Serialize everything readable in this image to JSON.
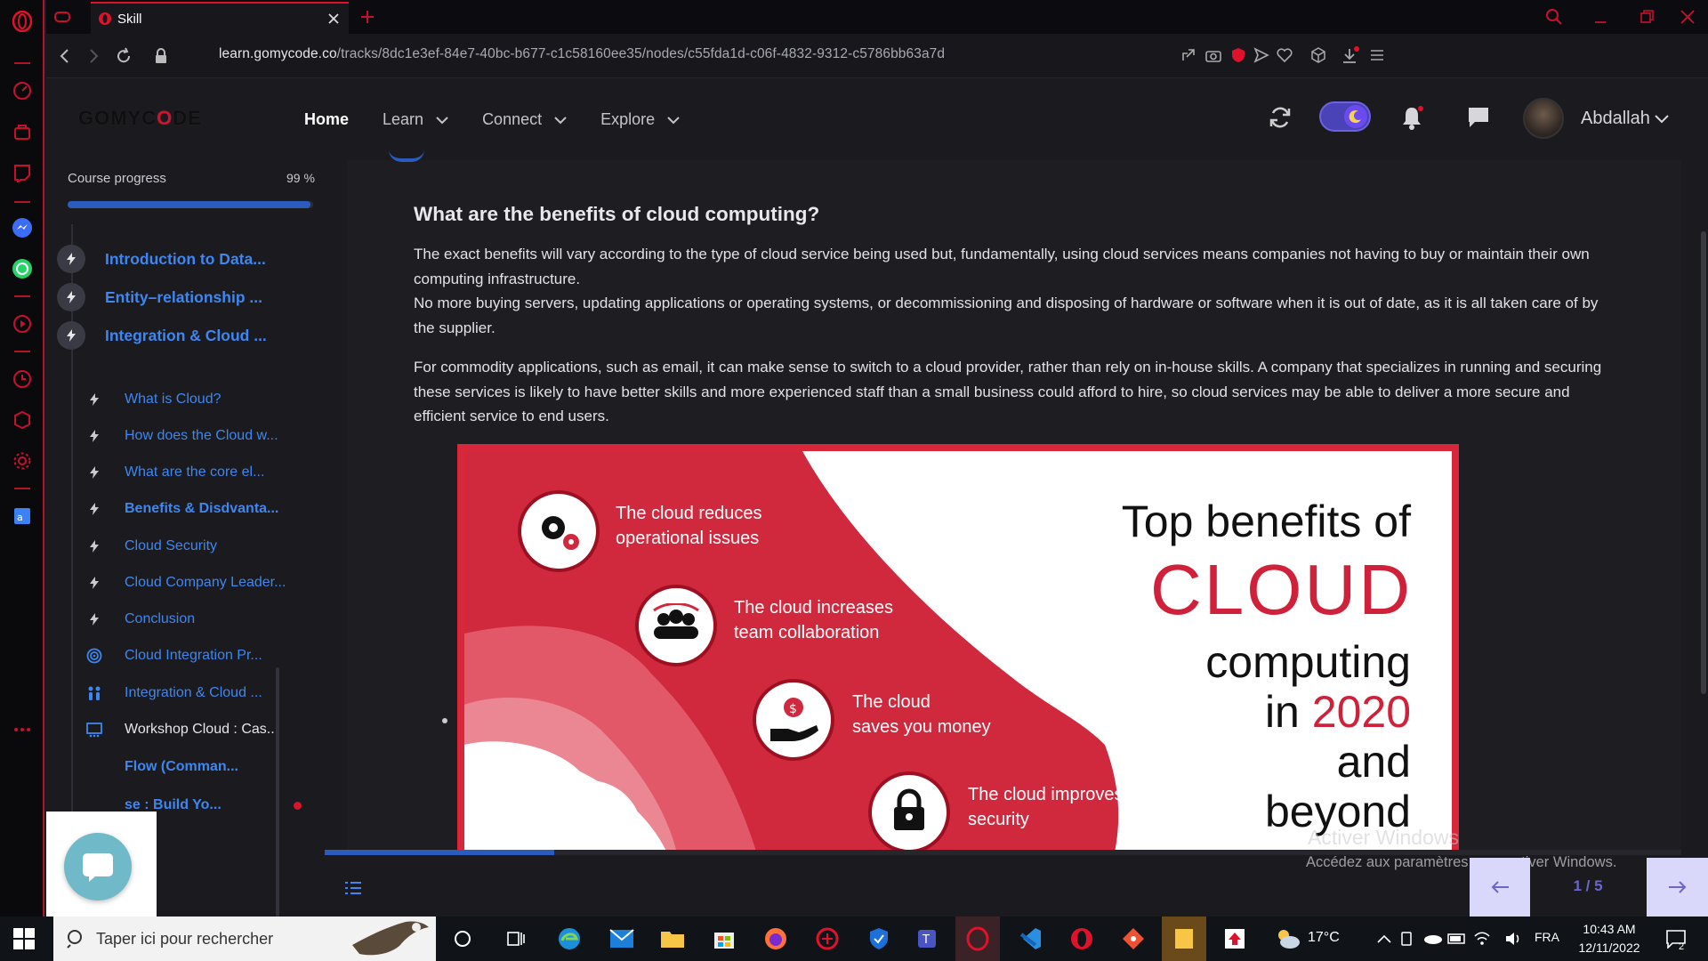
{
  "browser": {
    "tab_title": "Skill",
    "url_host": "learn.gomycode.co",
    "url_path": "/tracks/8dc1e3ef-84e7-40bc-b677-c1c58160ee35/nodes/c55fda1d-c06f-4832-9312-c5786bb63a7d"
  },
  "header": {
    "logo": "GOMYCODE",
    "nav": {
      "home": "Home",
      "learn": "Learn",
      "connect": "Connect",
      "explore": "Explore"
    },
    "username": "Abdallah"
  },
  "sidebar": {
    "progress_label": "Course progress",
    "progress_value": "99 %",
    "progress_fraction": 0.99,
    "modules": [
      {
        "label": "Introduction to Data..."
      },
      {
        "label": "Entity–relationship ..."
      },
      {
        "label": "Integration & Cloud ..."
      }
    ],
    "lessons": [
      {
        "label": "What is Cloud?"
      },
      {
        "label": "How does the Cloud w..."
      },
      {
        "label": "What are the core el..."
      },
      {
        "label": "Benefits & Disdvanta..."
      },
      {
        "label": "Cloud Security"
      },
      {
        "label": "Cloud Company Leader..."
      },
      {
        "label": "Conclusion"
      },
      {
        "label": "Cloud Integration Pr..."
      },
      {
        "label": "Integration & Cloud ..."
      },
      {
        "label": "Workshop Cloud : Cas..."
      },
      {
        "label": "Flow (Comman..."
      },
      {
        "label": "se : Build Yo..."
      }
    ]
  },
  "content": {
    "heading": "What are the benefits of cloud computing?",
    "paragraphs": [
      "The exact benefits will vary according to the type of cloud service being used but, fundamentally, using cloud services means companies not having to buy or maintain their own computing infrastructure.",
      "No more buying servers, updating applications or operating systems, or decommissioning and disposing of hardware or software when it is out of date, as it is all taken care of by the supplier.",
      "For commodity applications, such as email, it can make sense to switch to a cloud provider, rather than rely on in-house skills. A company that specializes in running and securing these services is likely to have better skills and more experienced staff than a small business could afford to hire, so cloud services may be able to deliver a more secure and efficient service to end users."
    ],
    "infographic": {
      "title_line1": "Top benefits of",
      "title_line2": "CLOUD",
      "title_line3": "computing",
      "title_line4a": "in ",
      "title_line4b": "2020",
      "title_line5": "and",
      "title_line6": "beyond",
      "items": [
        {
          "text": "The cloud reduces operational issues"
        },
        {
          "text": "The cloud increases team collaboration"
        },
        {
          "text": "The cloud saves you money"
        },
        {
          "text": "The cloud improves security"
        }
      ]
    }
  },
  "pager": {
    "text": "1 / 5"
  },
  "watermark": {
    "line1": "Activer Windows",
    "line2": "Accédez aux paramètres pour activer Windows."
  },
  "taskbar": {
    "search_placeholder": "Taper ici pour rechercher",
    "weather": "17°C",
    "lang": "FRA",
    "time": "10:43 AM",
    "date": "12/11/2022",
    "notif_count": "2"
  },
  "colors": {
    "accent": "#d4102f",
    "link": "#3e86f0",
    "progress": "#2a5bbd",
    "pager": "#d9d8fb"
  }
}
